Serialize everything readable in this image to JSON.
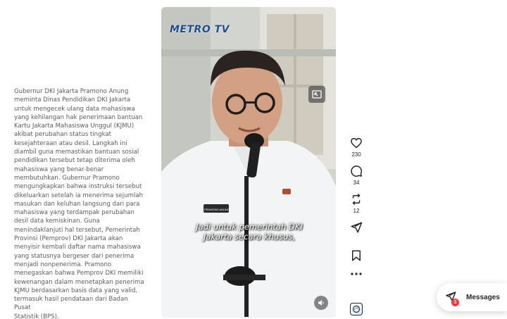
{
  "post": {
    "caption": "Gubernur DKI Jakarta Pramono Anung\nmeminta Dinas Pendidikan DKI Jakarta\nuntuk mengecek ulang data mahasiswa\nyang kehilangan hak penerimaan bantuan\nKartu Jakarta Mahasiswa Unggul (KJMU)\nakibat perubahan status tingkat\nkesejahteraan atau desil. Langkah ini\ndiambil guna memastikan bantuan sosial\npendidikan tersebut tetap diterima oleh\nmahasiswa yang benar-benar\nmembutuhkan. Gubernur Pramono\nmengungkapkan bahwa instruksi tersebut\ndikeluarkan setelah ia menerima sejumlah\nmasukan dan keluhan langsung dari para\nmahasiswa yang terdampak perubahan\ndesil data kemiskinan. Guna\nmenindaklanjuti hal tersebut, Pemerintah\nProvinsi (Pemprov) DKI Jakarta akan\nmenyisir kembali daftar nama mahasiswa\nyang statusnya bergeser dari penerima\nmenjadi nonpenerima. Pramono\nmenegaskan bahwa Pemprov DKI memiliki\nkewenangan dalam menetapkan penerima\nKJMU berdasarkan basis data yang valid,\ntermasuk hasil pendataan dari Badan Pusat\nStatistik (BPS)."
  },
  "video": {
    "channel_logo": "METRO TV",
    "subtitle_line1": "Jadi untuk pemerintah DKI",
    "subtitle_line2": "Jakarta secara khusus,",
    "name_tag": "PRAMONO ANUNG",
    "pip_icon": "picture-in-picture-icon",
    "mute_icon": "speaker-icon"
  },
  "actions": {
    "likes": "230",
    "comments": "34",
    "reposts": "12",
    "shares": "",
    "icons": [
      "heart-icon",
      "comment-icon",
      "repost-icon",
      "share-icon",
      "bookmark-icon",
      "more-icon"
    ]
  },
  "messages": {
    "label": "Messages",
    "badge_count": "3"
  },
  "colors": {
    "text": "#262626",
    "caption": "#5c5c5c",
    "badge": "#ff3040",
    "logo": "#1f4e8c"
  }
}
